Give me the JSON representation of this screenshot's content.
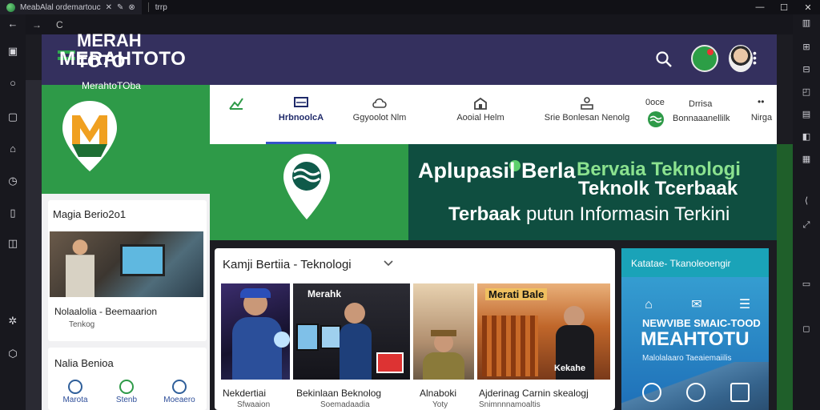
{
  "window": {
    "tab_title": "MeabAlal ordemartouc",
    "tab_url": "trrp",
    "min": "—",
    "max": "☐",
    "close": "✕"
  },
  "addr": {
    "back": "→",
    "reload": "C"
  },
  "header": {
    "logo_text": "MERAHTOTO"
  },
  "brand": {
    "line1": "MERAH",
    "line2": "TOTO",
    "subtitle": "MerahtoTOba"
  },
  "categories": [
    {
      "label": "Ekonomi"
    },
    {
      "label": "HrbnoolcA"
    },
    {
      "label": "Ggyoolot Nlm"
    },
    {
      "label": "Aooial Helm"
    },
    {
      "label": "Srie Bonlesan Nenolg"
    },
    {
      "label": "Bonnaaanellilk",
      "extra_top": "0oce",
      "extra_top2": "Drrisa"
    },
    {
      "label": "Nirga"
    }
  ],
  "hero": {
    "t1": "Aplupasil Berla",
    "t1b": "Bervaia Teknologi",
    "t2": "Teknolk Tcerbaak",
    "t3a": "Terbaak",
    "t3b": "putun Informasin Terkini"
  },
  "sidebar": {
    "card1_title": "Magia Berio2o1",
    "card1_cap1": "Nolaalolia - Beemaarion",
    "card1_cap2": "Tenkog",
    "card2_title": "Nalia Benioa",
    "quick": [
      {
        "label": "Marota"
      },
      {
        "label": "Stenb"
      },
      {
        "label": "Moeaero"
      }
    ]
  },
  "tech": {
    "title": "Kamji Bertiia - Teknologi",
    "cards": [
      {
        "cap": "Nekdertiai",
        "sub": "Sfwaaion",
        "badge": "Merahk"
      },
      {
        "cap": "Bekinlaan Beknolog",
        "sub": "Soemadaadia"
      },
      {
        "cap": "Alnaboki",
        "sub": "Yoty"
      },
      {
        "cap": "Ajderinag Carnin skealogj",
        "sub": "Snimnnnamoaltis",
        "badge": "Merati Bale",
        "badge2": "Kekahe"
      }
    ]
  },
  "rpanel": {
    "title": "Katatae- Tkanoleoengir",
    "t1": "NEWVIBE SMAIC-TOOD",
    "t2": "MEAHTOTU",
    "t3": "Malolalaaro Taeaiemaiilis"
  },
  "colors": {
    "header": "#34305e",
    "green": "#2e9a48",
    "dark_green": "#0f4e40",
    "accent_blue": "#3552c9"
  }
}
